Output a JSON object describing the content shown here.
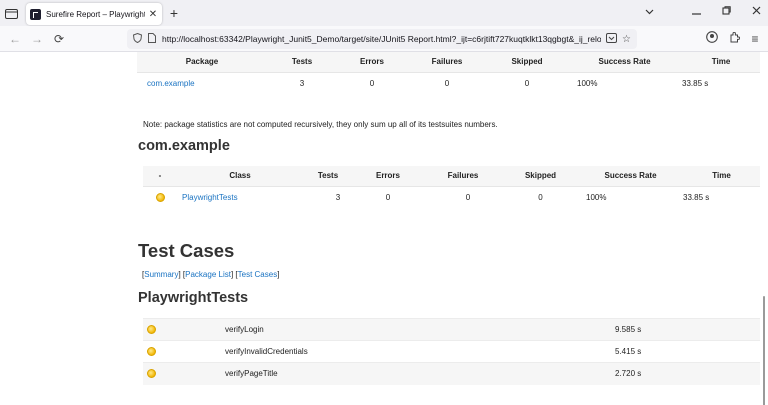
{
  "browser": {
    "tab_title": "Surefire Report – Playwright_Ju",
    "tab_close": "✕",
    "new_tab": "+",
    "url": "http://localhost:63342/Playwright_Junit5_Demo/target/site/JUnit5 Report.html?_ijt=c6rjtift727kuqtklkt13qgbgt&_ij_relo",
    "icons": {
      "tab_list": "tab-list-icon",
      "back": "back-arrow-icon",
      "forward": "forward-arrow-icon",
      "reload": "reload-icon",
      "shield": "shield-icon",
      "page": "page-info-icon",
      "save": "save-to-pocket-icon",
      "bookmark": "bookmark-star-icon",
      "account": "account-icon",
      "extensions": "extensions-icon",
      "menu": "hamburger-menu-icon",
      "minimize": "minimize-icon",
      "maximize": "maximize-icon",
      "close": "close-icon",
      "chevron": "chevron-down-icon"
    }
  },
  "summary_table": {
    "headers": [
      "Package",
      "Tests",
      "Errors",
      "Failures",
      "Skipped",
      "Success Rate",
      "Time"
    ],
    "row": {
      "package": "com.example",
      "tests": "3",
      "errors": "0",
      "failures": "0",
      "skipped": "0",
      "success_rate": "100%",
      "time": "33.85 s"
    }
  },
  "note": "Note: package statistics are not computed recursively, they only sum up all of its testsuites numbers.",
  "package_section": {
    "title": "com.example",
    "headers": [
      "-",
      "Class",
      "Tests",
      "Errors",
      "Failures",
      "Skipped",
      "Success Rate",
      "Time"
    ],
    "row": {
      "class": "PlaywrightTests",
      "tests": "3",
      "errors": "0",
      "failures": "0",
      "skipped": "0",
      "success_rate": "100%",
      "time": "33.85 s"
    }
  },
  "test_cases": {
    "title": "Test Cases",
    "links": {
      "summary": "Summary",
      "package_list": "Package List",
      "test_cases": "Test Cases"
    },
    "class_title": "PlaywrightTests",
    "rows": [
      {
        "name": "verifyLogin",
        "time": "9.585 s"
      },
      {
        "name": "verifyInvalidCredentials",
        "time": "5.415 s"
      },
      {
        "name": "verifyPageTitle",
        "time": "2.720 s"
      }
    ]
  },
  "colors": {
    "link": "#1a73c2",
    "header_bg": "#f6f6f6",
    "status_icon": "#f2b705"
  }
}
